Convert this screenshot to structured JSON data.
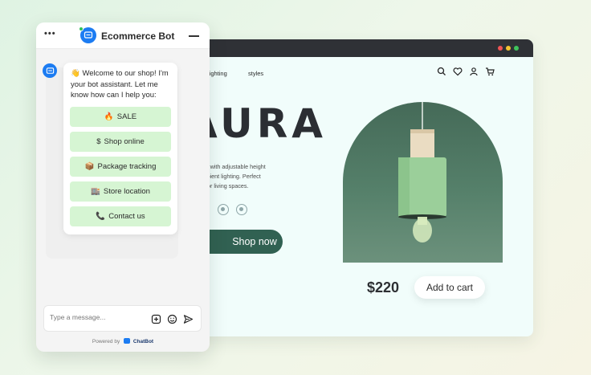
{
  "chat": {
    "menu_glyph": "•••",
    "title": "Ecommerce Bot",
    "welcome_message": "👋 Welcome to our shop! I'm your bot assistant. Let me know how can I help you:",
    "quick_replies": [
      {
        "emoji": "🔥",
        "label": "SALE"
      },
      {
        "emoji": "$",
        "label": "Shop online"
      },
      {
        "emoji": "📦",
        "label": "Package tracking"
      },
      {
        "emoji": "🏬",
        "label": "Store location"
      },
      {
        "emoji": "📞",
        "label": "Contact us"
      }
    ],
    "input_placeholder": "Type a message...",
    "powered_by": "Powered by",
    "brand": "ChatBot",
    "icons": [
      "menu-dots",
      "bot-avatar",
      "minimize",
      "add",
      "emoji",
      "send"
    ]
  },
  "shop": {
    "nav": [
      "lighting",
      "styles"
    ],
    "nav_icons": [
      "search-icon",
      "heart-icon",
      "user-icon",
      "cart-icon"
    ],
    "hero_title": "AURA",
    "hero_description": "lamp with adjustable height soft, ambient lighting. Perfect drooms or living spaces.",
    "hero_desc_lines": [
      "lamp with adjustable height",
      "soft, ambient lighting. Perfect",
      "drooms or living spaces."
    ],
    "shop_now_label": "Shop now",
    "price": "$220",
    "add_to_cart_label": "Add to cart"
  },
  "colors": {
    "accent_green": "#316152",
    "quick_reply_bg": "#d6f5d3",
    "bot_blue": "#1c7cf2",
    "browser_bar": "#2f3136",
    "window_dots": [
      "#f05454",
      "#f4c331",
      "#3fc45c"
    ]
  }
}
